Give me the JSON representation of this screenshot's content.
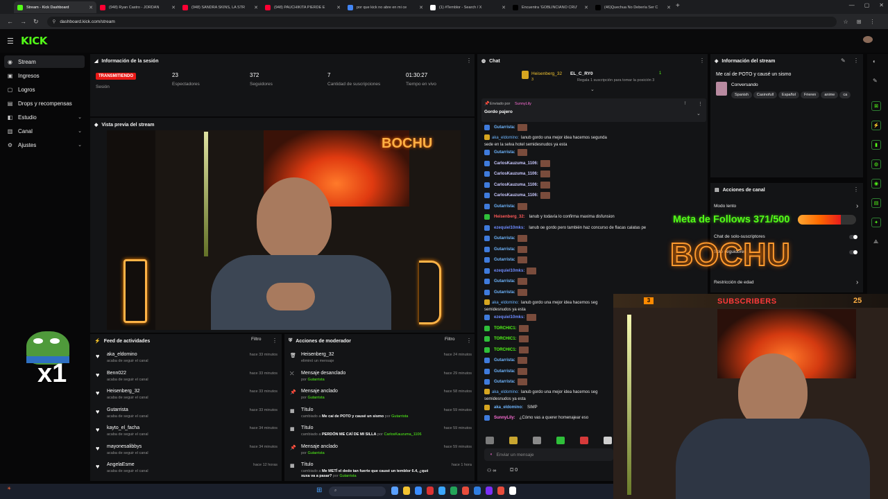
{
  "browser": {
    "tabs": [
      {
        "title": "Stream - Kick Dashboard",
        "color": "#53fc18",
        "active": true
      },
      {
        "title": "(948) Ryan Castro - JORDAN",
        "color": "#ff0033"
      },
      {
        "title": "(948) SANDRA SKINS, LA STR",
        "color": "#ff0033"
      },
      {
        "title": "(948) PAUCHIKITA PIERDE E",
        "color": "#ff0033"
      },
      {
        "title": "por que kick no abre en mi ce",
        "color": "#4285f4"
      },
      {
        "title": "(1) #Temblor - Search / X",
        "color": "#ffffff"
      },
      {
        "title": "Encuentra 'GOBLINCIANO CRU'",
        "color": "#000000"
      },
      {
        "title": "(46)Quechua No Debería Ser C",
        "color": "#000000"
      }
    ],
    "url": "dashboard.kick.com/stream"
  },
  "header": {
    "logo": "KICK"
  },
  "sidebar": {
    "items": [
      {
        "label": "Stream",
        "icon": "broadcast-icon",
        "glyph": "◉",
        "active": true
      },
      {
        "label": "Ingresos",
        "icon": "money-icon",
        "glyph": "▣"
      },
      {
        "label": "Logros",
        "icon": "trophy-icon",
        "glyph": "▢"
      },
      {
        "label": "Drops y recompensas",
        "icon": "gift-icon",
        "glyph": "▤"
      },
      {
        "label": "Estudio",
        "icon": "studio-icon",
        "glyph": "◧",
        "chevron": true
      },
      {
        "label": "Canal",
        "icon": "channel-icon",
        "glyph": "▥",
        "chevron": true
      },
      {
        "label": "Ajustes",
        "icon": "gear-icon",
        "glyph": "⚙",
        "chevron": true
      }
    ]
  },
  "session": {
    "title": "Información de la sesión",
    "badge": "TRANSMITIENDO",
    "badge_label": "Sesión",
    "stats": [
      {
        "value": "23",
        "label": "Espectadores"
      },
      {
        "value": "372",
        "label": "Seguidores"
      },
      {
        "value": "7",
        "label": "Cantidad de suscripciones"
      },
      {
        "value": "01:30:27",
        "label": "Tiempo en vivo"
      }
    ]
  },
  "preview": {
    "title": "Vista previa del stream",
    "brand": "BOCHU"
  },
  "activity": {
    "title": "Feed de actividades",
    "filter": "Filtro",
    "items": [
      {
        "name": "aka_eldomino",
        "sub": "acaba de seguir el canal",
        "time": "hace 33 minutos"
      },
      {
        "name": "Benn022",
        "sub": "acaba de seguir el canal",
        "time": "hace 33 minutos"
      },
      {
        "name": "Heisenberg_32",
        "sub": "acaba de seguir el canal",
        "time": "hace 33 minutos"
      },
      {
        "name": "Gutarrista",
        "sub": "acaba de seguir el canal",
        "time": "hace 33 minutos"
      },
      {
        "name": "kayto_el_facha",
        "sub": "acaba de seguir el canal",
        "time": "hace 34 minutos"
      },
      {
        "name": "mayonesalibbys",
        "sub": "acaba de seguir el canal",
        "time": "hace 34 minutos"
      },
      {
        "name": "AngelaEsme",
        "sub": "acaba de seguir el canal",
        "time": "hace 12 horas"
      }
    ]
  },
  "mod": {
    "title": "Acciones de moderador",
    "filter": "Filtro",
    "items": [
      {
        "icon": "trash-icon",
        "glyph": "🗑",
        "name": "Heisenberg_32",
        "pre": "eliminó un mensaje",
        "hl": "",
        "post": "",
        "time": "hace 24 minutos"
      },
      {
        "icon": "unpin-icon",
        "glyph": "⤫",
        "name": "Mensaje desanclado",
        "pre": "por ",
        "hl": "Gutarrista",
        "post": "",
        "time": "hace 29 minutos"
      },
      {
        "icon": "pin-icon",
        "glyph": "📌",
        "name": "Mensaje anclado",
        "pre": "por ",
        "hl": "Gutarrista",
        "post": "",
        "time": "hace 58 minutos"
      },
      {
        "icon": "title-icon",
        "glyph": "▦",
        "name": "Título",
        "pre": "cambiado a ",
        "bold": "Me caí de POTO y causé un sismo",
        "mid": " por ",
        "hl": "Gutarrista",
        "time": "hace 59 minutos"
      },
      {
        "icon": "title-icon",
        "glyph": "▦",
        "name": "Título",
        "pre": "cambiado a ",
        "bold": "PERDÓN ME CAÍ DE MI SILLA",
        "mid": " por ",
        "hl": "CarlosKauzuma_1106",
        "time": "hace 59 minutos"
      },
      {
        "icon": "pin-icon",
        "glyph": "📌",
        "name": "Mensaje anclado",
        "pre": "por ",
        "hl": "Gutarrista",
        "post": "",
        "time": "hace 59 minutos"
      },
      {
        "icon": "title-icon",
        "glyph": "▦",
        "name": "Título",
        "pre": "cambiado a ",
        "bold": "Me METÍ el dedo tan fuerte que causé un temblor 6.4, ¿qué xuxa va a pasar?",
        "mid": " por ",
        "hl": "Gutarrista",
        "time": "hace 1 hora"
      }
    ]
  },
  "chat": {
    "title": "Chat",
    "top_gifter": "Heisenberg_32",
    "top_gifter_count": "3",
    "gift_user": "EL_C_RY0",
    "gift_count": "1",
    "gift_text": "Regala 1 suscripción para tomar la posición 3",
    "pinned_by_label": "Enviado por",
    "pinned_by": "SunnyLily",
    "pinned_msg": "Gordo pajero",
    "messages": [
      {
        "badge": "b-blue",
        "user": "Gutarrista:",
        "ucolor": "#6fb6ff",
        "text": "",
        "emotes": 1
      },
      {
        "badge": "b-gold",
        "user": "aka_eldomino:",
        "ucolor": "#6fb6ff",
        "text": "lanub gordo una mejor idea hacemos segunda sede en la selva hotel semidesnudos ya esta",
        "emotes": 0,
        "wrap": true
      },
      {
        "badge": "b-blue",
        "user": "Gutarrista:",
        "ucolor": "#6fb6ff",
        "text": "",
        "emotes": 1
      },
      {
        "badge": "b-blue",
        "user": "CarlosKauzuma_1106:",
        "ucolor": "#c9c9ff",
        "text": "",
        "emotes": 1
      },
      {
        "badge": "b-blue",
        "user": "CarlosKauzuma_1106:",
        "ucolor": "#c9c9ff",
        "text": "",
        "emotes": 1
      },
      {
        "badge": "b-blue",
        "user": "CarlosKauzuma_1106:",
        "ucolor": "#c9c9ff",
        "text": "",
        "emotes": 1
      },
      {
        "badge": "b-blue",
        "user": "CarlosKauzuma_1106:",
        "ucolor": "#c9c9ff",
        "text": "",
        "emotes": 1
      },
      {
        "badge": "b-blue",
        "user": "Gutarrista:",
        "ucolor": "#6fb6ff",
        "text": "",
        "emotes": 1
      },
      {
        "badge": "b-green",
        "user": "Heisenberg_32:",
        "ucolor": "#ff5a5a",
        "text": "lanub y todavía lo confirma maxima disfunsion",
        "emotes": 0
      },
      {
        "badge": "b-blue",
        "user": "ezequiel10mks:",
        "ucolor": "#6f8cff",
        "text": "lanub oe gordo pero también haz concurso de flacas calatas pe",
        "emotes": 0
      },
      {
        "badge": "b-blue",
        "user": "Gutarrista:",
        "ucolor": "#6fb6ff",
        "text": "",
        "emotes": 1
      },
      {
        "badge": "b-blue",
        "user": "Gutarrista:",
        "ucolor": "#6fb6ff",
        "text": "",
        "emotes": 1
      },
      {
        "badge": "b-blue",
        "user": "Gutarrista:",
        "ucolor": "#6fb6ff",
        "text": "",
        "emotes": 1
      },
      {
        "badge": "b-blue",
        "user": "ezequiel10mks:",
        "ucolor": "#6f8cff",
        "text": "",
        "emotes": 1
      },
      {
        "badge": "b-blue",
        "user": "Gutarrista:",
        "ucolor": "#6fb6ff",
        "text": "",
        "emotes": 1
      },
      {
        "badge": "b-blue",
        "user": "Gutarrista:",
        "ucolor": "#6fb6ff",
        "text": "",
        "emotes": 1
      },
      {
        "badge": "b-gold",
        "user": "aka_eldomino:",
        "ucolor": "#6fb6ff",
        "text": "lanub gordo una mejor idea hacemos seg semidesnudos ya esta",
        "emotes": 0,
        "wrap": true
      },
      {
        "badge": "b-blue",
        "user": "ezequiel10mks:",
        "ucolor": "#6f8cff",
        "text": "",
        "emotes": 1
      },
      {
        "badge": "b-green",
        "user": "TORCHIC1:",
        "ucolor": "#53fc18",
        "text": "",
        "emotes": 1
      },
      {
        "badge": "b-green",
        "user": "TORCHIC1:",
        "ucolor": "#53fc18",
        "text": "",
        "emotes": 1
      },
      {
        "badge": "b-green",
        "user": "TORCHIC1:",
        "ucolor": "#53fc18",
        "text": "",
        "emotes": 1
      },
      {
        "badge": "b-blue",
        "user": "Gutarrista:",
        "ucolor": "#6fb6ff",
        "text": "",
        "emotes": 1
      },
      {
        "badge": "b-blue",
        "user": "Gutarrista:",
        "ucolor": "#6fb6ff",
        "text": "",
        "emotes": 1
      },
      {
        "badge": "b-blue",
        "user": "Gutarrista:",
        "ucolor": "#6fb6ff",
        "text": "",
        "emotes": 1
      },
      {
        "badge": "b-gold",
        "user": "aka_eldomino:",
        "ucolor": "#6fb6ff",
        "text": "lanub gordo una mejor idea hacemos seg semidesnudos ya esta",
        "emotes": 0,
        "wrap": true
      },
      {
        "badge": "b-gold",
        "user": "aka_eldomino:",
        "ucolor": "#6fb6ff",
        "text": "SIMP",
        "emotes": 0
      },
      {
        "badge": "b-blue",
        "user": "SunnyLily:",
        "ucolor": "#ff6fd8",
        "text": "¿Cómo vas a querer homenajear eso",
        "emotes": 0
      }
    ],
    "input_placeholder": "Enviar un mensaje",
    "footer_left": "∞",
    "footer_count": "0"
  },
  "info": {
    "title": "Información del stream",
    "stream_title": "Me caí de POTO y causé un sismo",
    "category": "Conversando",
    "tags": [
      "Spanish",
      "Casinofull",
      "Español",
      "Frieren",
      "anime",
      "ca"
    ]
  },
  "channel_actions": {
    "title": "Acciones de canal",
    "rows": [
      {
        "label": "Modo lento",
        "kind": "chevron"
      },
      {
        "label": "Chat de solo-suscriptores",
        "kind": "toggle"
      },
      {
        "label": "Solo seguidores",
        "kind": "toggle"
      },
      {
        "label": "Restricción de edad",
        "kind": "chevron"
      }
    ]
  },
  "overlay": {
    "goal_label": "Meta de Follows 371/500",
    "goal_progress": 0.742,
    "brand": "BOCHU",
    "subs_label": "SUBSCRIBERS",
    "subs_count": "25",
    "subs_badge": "3",
    "multiplier": "x1"
  },
  "colors": {
    "accent": "#53fc18",
    "live": "#e91916",
    "panel": "#131416"
  }
}
